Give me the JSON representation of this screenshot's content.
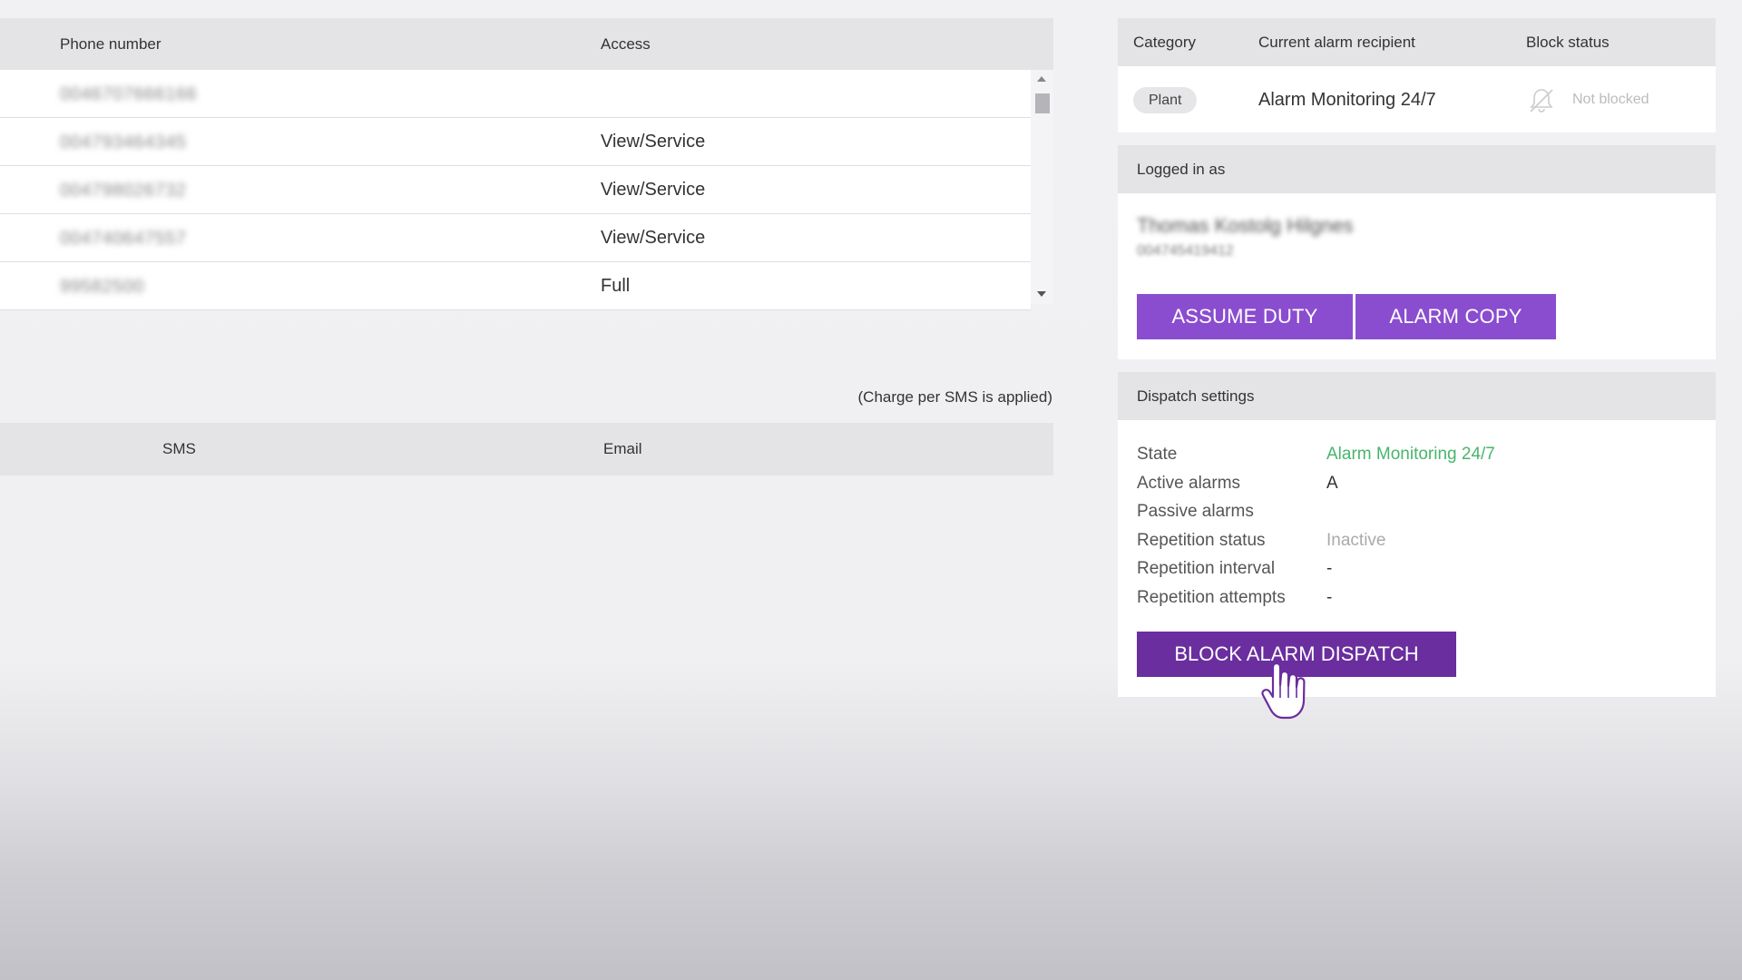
{
  "phone_table": {
    "headers": {
      "phone": "Phone number",
      "access": "Access"
    },
    "rows": [
      {
        "phone": "0046707666166",
        "access": ""
      },
      {
        "phone": "004793464345",
        "access": "View/Service"
      },
      {
        "phone": "004798026732",
        "access": "View/Service"
      },
      {
        "phone": "004740647557",
        "access": "View/Service"
      },
      {
        "phone": "99582500",
        "access": "Full"
      }
    ]
  },
  "notifications": {
    "note": "(Charge per SMS is applied)",
    "headers": {
      "sms": "SMS",
      "email": "Email"
    }
  },
  "alarm_panel": {
    "headers": {
      "category": "Category",
      "recipient": "Current alarm recipient",
      "block": "Block status"
    },
    "row": {
      "category": "Plant",
      "recipient": "Alarm Monitoring 24/7",
      "block_status": "Not blocked",
      "block_icon": "bell-off-icon"
    }
  },
  "logged_in": {
    "title": "Logged in as",
    "name": "Thomas Kostolg Hilgnes",
    "phone": "004745419412",
    "assume_button": "ASSUME DUTY",
    "copy_button": "ALARM COPY"
  },
  "dispatch": {
    "title": "Dispatch settings",
    "state_label": "State",
    "state_value": "Alarm Monitoring 24/7",
    "active_label": "Active alarms",
    "active_value": "A",
    "passive_label": "Passive alarms",
    "passive_value": "",
    "rep_status_label": "Repetition status",
    "rep_status_value": "Inactive",
    "rep_interval_label": "Repetition interval",
    "rep_interval_value": "-",
    "rep_attempts_label": "Repetition attempts",
    "rep_attempts_value": "-",
    "block_button": "BLOCK ALARM DISPATCH"
  },
  "colors": {
    "accent": "#8a4dcf",
    "accent_dark": "#6a2e9f",
    "state_green": "#48b56c"
  }
}
